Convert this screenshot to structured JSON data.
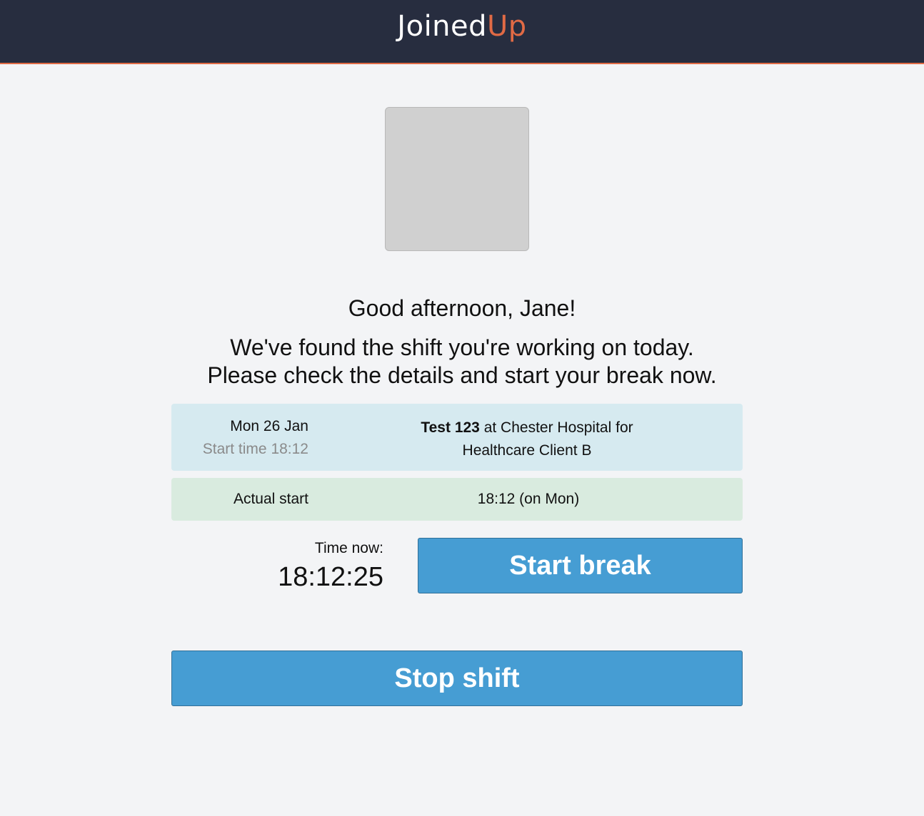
{
  "header": {
    "logo_part1": "Joined",
    "logo_part2": "Up"
  },
  "greeting": "Good afternoon, Jane!",
  "message": {
    "line1": "We've found the shift you're working on today.",
    "line2": "Please check the details and start your break now."
  },
  "shift": {
    "date": "Mon 26 Jan",
    "start_time": "Start time 18:12",
    "name": "Test 123",
    "location_text": " at Chester Hospital for",
    "client": "Healthcare Client B"
  },
  "actual": {
    "label": "Actual start",
    "value": "18:12 (on Mon)"
  },
  "clock": {
    "label": "Time now:",
    "value": "18:12:25"
  },
  "buttons": {
    "start_break": "Start break",
    "stop_shift": "Stop shift"
  },
  "colors": {
    "header_bg": "#272d3f",
    "accent": "#e06a45",
    "button": "#469dd3",
    "shift_box": "#d6eaf0",
    "actual_box": "#d9ebdf"
  }
}
